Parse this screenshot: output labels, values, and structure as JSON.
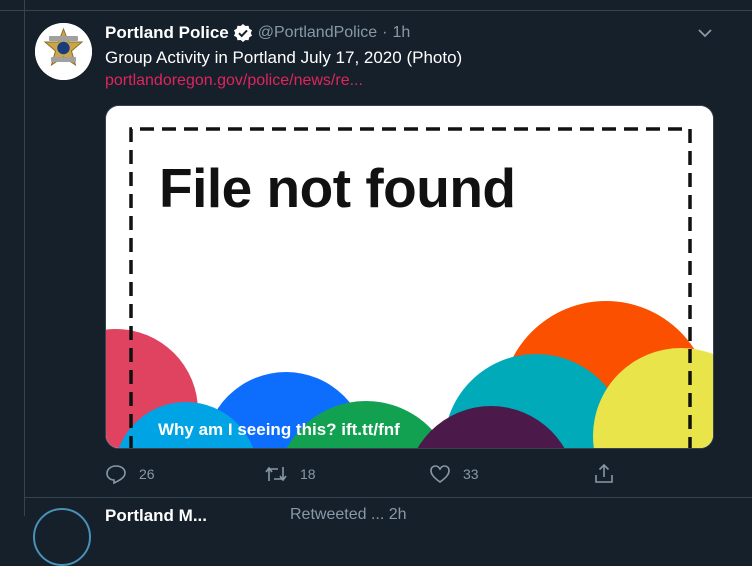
{
  "tweet": {
    "author_name": "Portland Police",
    "handle": "@PortlandPolice",
    "separator": "·",
    "time": "1h",
    "text": "Group Activity in Portland July 17, 2020 (Photo)",
    "link": "portlandoregon.gov/police/news/re...",
    "media": {
      "title": "File not found",
      "footer": "Why am I seeing this? ift.tt/fnf"
    },
    "actions": {
      "replies": "26",
      "retweets": "18",
      "likes": "33"
    }
  },
  "next_tweet": {
    "author_name": "Portland M...",
    "rest": "Retweeted ... 2h"
  },
  "colors": {
    "background": "#15202b",
    "secondary_text": "#8899a6",
    "link": "#e0245e",
    "divider": "#38444d",
    "verified": "#ffffff"
  },
  "icons": [
    "verified-badge-icon",
    "chevron-down-icon",
    "reply-icon",
    "retweet-icon",
    "like-icon",
    "share-icon"
  ]
}
